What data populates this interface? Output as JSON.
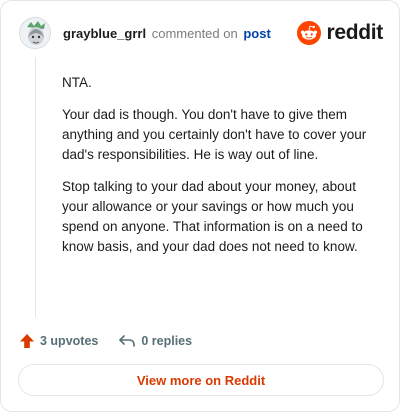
{
  "header": {
    "username": "grayblue_grrl",
    "verb": "commented on",
    "post_link": "post"
  },
  "brand": {
    "wordmark": "reddit",
    "icon": "reddit-logo-icon",
    "color": "#ff4500"
  },
  "comment": {
    "paragraphs": [
      "NTA.",
      "Your dad is though. You don't have to give them anything and you certainly don't have to cover your dad's responsibilities. He is way out of line.",
      "Stop talking to your dad about your money, about your allowance or your savings or how much you spend on anyone. That information is on a need to know basis, and your dad does not need to know."
    ]
  },
  "actions": {
    "upvotes": "3 upvotes",
    "replies": "0 replies",
    "upvote_color": "#d93a00"
  },
  "footer": {
    "view_more": "View more on Reddit"
  }
}
